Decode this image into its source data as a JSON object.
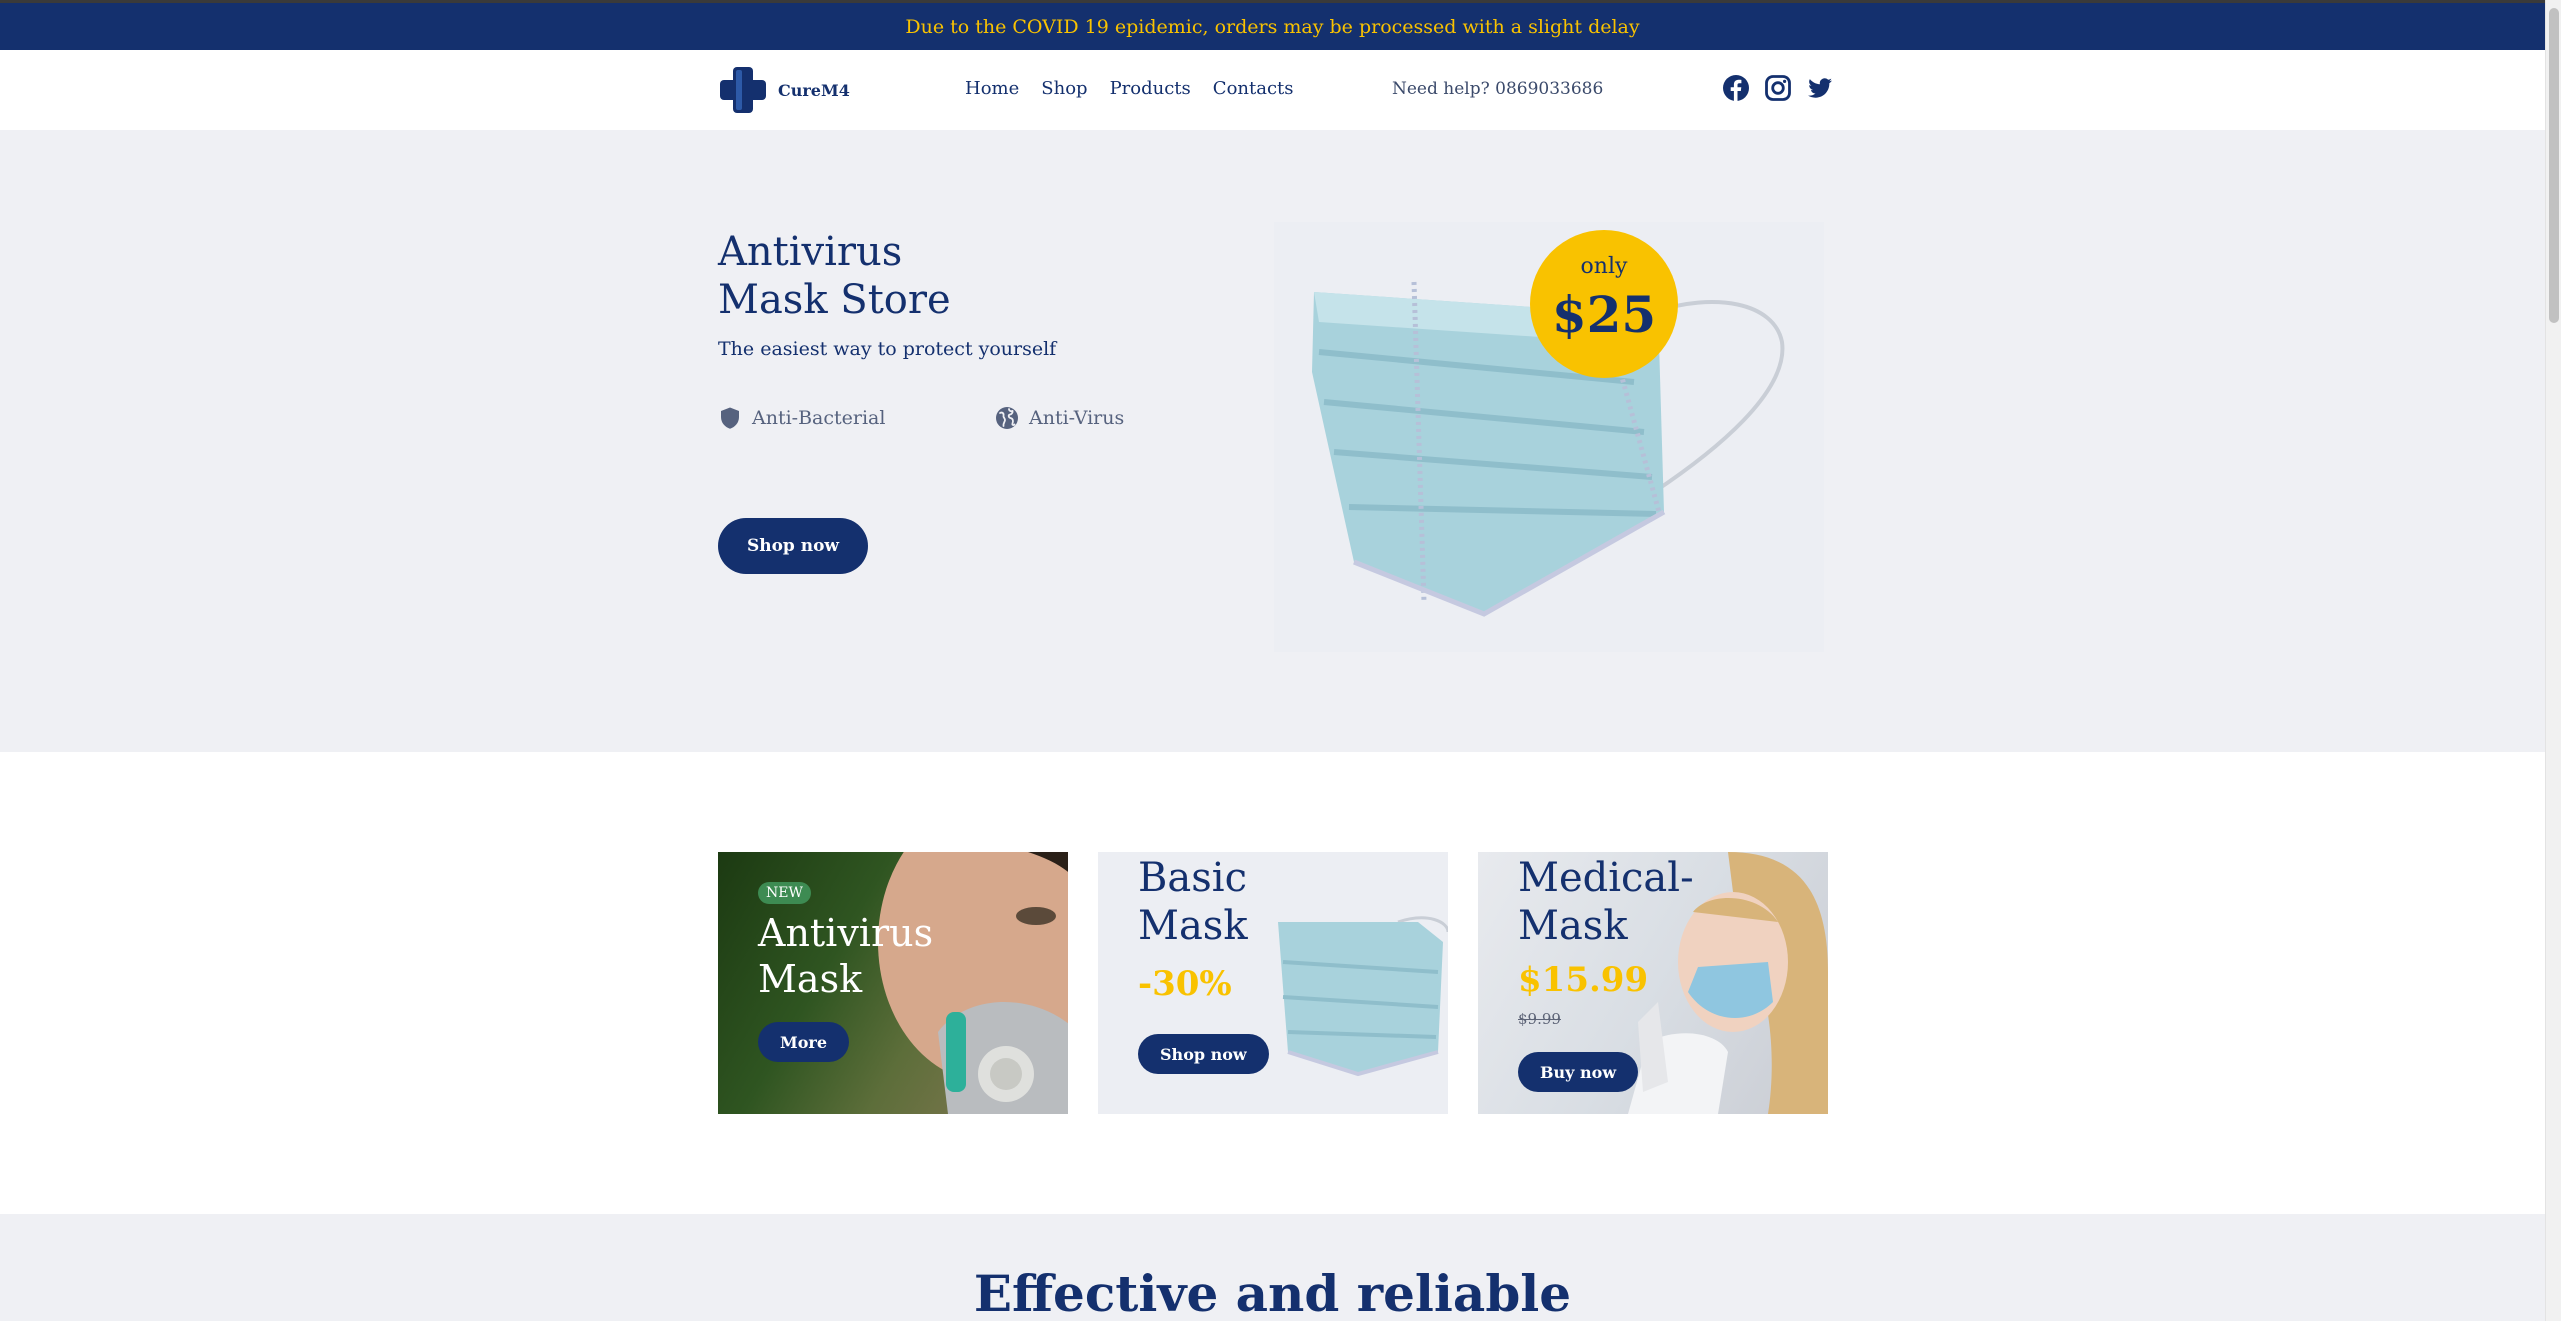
{
  "announcement": "Due to the COVID 19 epidemic, orders may be processed with a slight delay",
  "header": {
    "brand": "CureM4",
    "nav": [
      "Home",
      "Shop",
      "Products",
      "Contacts"
    ],
    "help": "Need help? 0869033686",
    "social_icons": [
      "facebook-icon",
      "instagram-icon",
      "twitter-icon"
    ]
  },
  "hero": {
    "title_line1": "Antivirus",
    "title_line2": "Mask Store",
    "subtitle": "The easiest way to protect yourself",
    "features": [
      {
        "icon": "shield-icon",
        "label": "Anti-Bacterial"
      },
      {
        "icon": "globe-icon",
        "label": "Anti-Virus"
      }
    ],
    "button": "Shop now",
    "price_prefix": "only",
    "price": "$25"
  },
  "cards": [
    {
      "badge": "NEW",
      "title_line1": "Antivirus",
      "title_line2": "Mask",
      "button": "More"
    },
    {
      "title_line1": "Basic",
      "title_line2": "Mask",
      "discount": "-30%",
      "button": "Shop now"
    },
    {
      "title_line1": "Medical-",
      "title_line2": "Mask",
      "price": "$15.99",
      "old_price": "$9.99",
      "button": "Buy now"
    }
  ],
  "section_heading": "Effective and reliable",
  "colors": {
    "brand": "#14306e",
    "accent": "#f9c200",
    "hero_bg": "#eff0f4",
    "new_badge": "#3d8b52"
  }
}
